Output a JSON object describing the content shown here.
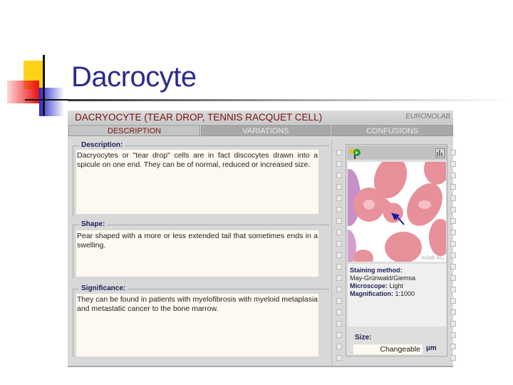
{
  "slide": {
    "title": "Dacrocyte"
  },
  "app": {
    "header_title": "DACRYOCYTE (TEAR DROP, TENNIS RACQUET CELL)",
    "logo_text": "EURONOLAB"
  },
  "tabs": [
    {
      "label": "DESCRIPTION",
      "active": true
    },
    {
      "label": "VARIATIONS",
      "active": false
    },
    {
      "label": "CONFUSIONS",
      "active": false
    }
  ],
  "sections": [
    {
      "legend": "Description:",
      "text": "Dacryocytes or \"tear drop\" cells are in fact discocytes drawn into a spicule on one end. They can be of normal, reduced or increased size."
    },
    {
      "legend": "Shape:",
      "text": "Pear shaped with a more or less extended tail that sometimes ends in a swelling."
    },
    {
      "legend": "Significance:",
      "text": "They can be found in patients with myelofibrosis with myeloid metaplasia and metastatic cancer to the bone marrow."
    }
  ],
  "image": {
    "watermark": "nolab AG",
    "icons": [
      "flag-arrow-icon",
      "chart-icon"
    ]
  },
  "info": {
    "staining_label": "Staining method:",
    "staining_value": "May-Grünwald/Giemsa",
    "microscope_label": "Microscope:",
    "microscope_value": "Light",
    "magnification_label": "Magnification:",
    "magnification_value": "1:1000"
  },
  "size": {
    "label": "Size:",
    "value": "Changeable",
    "unit": "µm"
  },
  "colors": {
    "title": "#2b2b8c",
    "header": "#7a1414",
    "legend": "#1e1e5a"
  }
}
